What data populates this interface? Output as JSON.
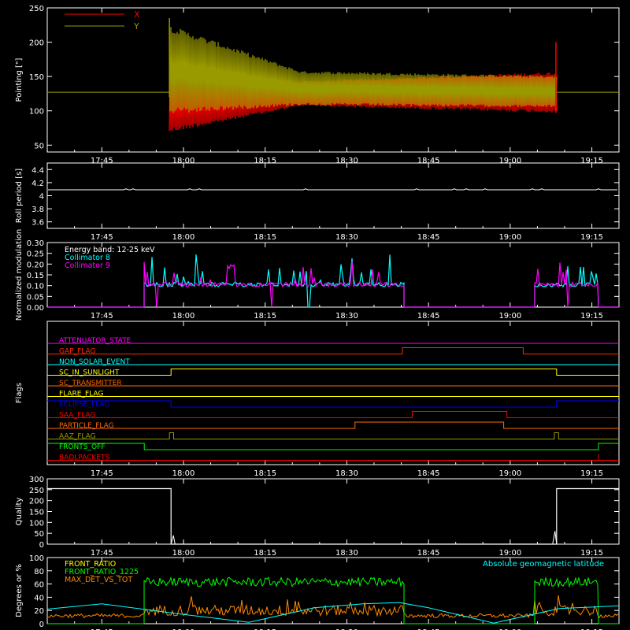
{
  "chart_data": [
    {
      "type": "line",
      "ylabel": "Pointing [\"]",
      "ylim": [
        40,
        250
      ],
      "yticks": [
        50,
        100,
        150,
        200,
        250
      ],
      "xticks": [
        "17:45",
        "18:00",
        "18:15",
        "18:30",
        "18:45",
        "19:00",
        "19:15"
      ],
      "xlim": [
        17.583,
        19.333
      ],
      "series": [
        {
          "name": "X",
          "color": "#ff0000",
          "baseline": 127,
          "segments": [
            {
              "t0": 17.957,
              "t1": 18.36,
              "center0": 118,
              "center1": 125,
              "amp0": 50,
              "amp1": 18
            },
            {
              "t0": 18.36,
              "t1": 19.142,
              "center0": 125,
              "center1": 127,
              "amp0": 18,
              "amp1": 30
            }
          ],
          "spike": {
            "t": 19.14,
            "values": [
              200,
              97
            ]
          }
        },
        {
          "name": "Y",
          "color": "#999900",
          "baseline": 127,
          "segments": [
            {
              "t0": 17.957,
              "t1": 18.36,
              "center0": 160,
              "center1": 133,
              "amp0": 65,
              "amp1": 25
            },
            {
              "t0": 18.36,
              "t1": 19.142,
              "center0": 133,
              "center1": 128,
              "amp0": 25,
              "amp1": 23
            }
          ],
          "spike": {
            "t": 17.957,
            "values": [
              235,
              120
            ]
          }
        }
      ]
    },
    {
      "type": "line",
      "ylabel": "Roll period [s]",
      "ylim": [
        3.5,
        4.5
      ],
      "yticks": [
        3.6,
        3.8,
        4.0,
        4.2,
        4.4
      ],
      "xticks": [
        "17:45",
        "18:00",
        "18:15",
        "18:30",
        "18:45",
        "19:00",
        "19:15"
      ],
      "series": [
        {
          "name": "",
          "color": "#ffffff",
          "value": 4.09
        }
      ]
    },
    {
      "type": "line",
      "ylabel": "Normalized modulation",
      "ylim": [
        0,
        0.3
      ],
      "yticks": [
        "0.00",
        "0.05",
        "0.10",
        "0.15",
        "0.20",
        "0.25",
        "0.30"
      ],
      "xticks": [
        "17:45",
        "18:00",
        "18:15",
        "18:30",
        "18:45",
        "19:00",
        "19:15"
      ],
      "legend": [
        {
          "label": "Energy band:  12-25 keV",
          "color": "#ffffff"
        },
        {
          "label": "Collimator 8",
          "color": "#00ffff"
        },
        {
          "label": "Collimator 9",
          "color": "#ff00ff"
        }
      ],
      "active_intervals": [
        [
          17.88,
          18.675
        ],
        [
          19.075,
          19.27
        ]
      ],
      "typical_level": 0.1,
      "max_spike": 0.28
    },
    {
      "type": "line",
      "ylabel": "Flags",
      "xticks": [
        "17:45",
        "18:00",
        "18:15",
        "18:30",
        "18:45",
        "19:00",
        "19:15"
      ],
      "flags": [
        {
          "name": "ATTENUATOR_STATE",
          "color": "#ff00ff",
          "steps": [
            [
              17.583,
              0
            ]
          ]
        },
        {
          "name": "GAP_FLAG",
          "color": "#ff2a00",
          "steps": [
            [
              17.583,
              0
            ],
            [
              18.67,
              1
            ],
            [
              19.04,
              0
            ]
          ]
        },
        {
          "name": "NON_SOLAR_EVENT",
          "color": "#00ffff",
          "steps": [
            [
              17.583,
              0
            ]
          ]
        },
        {
          "name": "SC_IN_SUNLIGHT",
          "color": "#ffff00",
          "steps": [
            [
              17.583,
              0
            ],
            [
              17.962,
              1
            ],
            [
              19.142,
              0
            ]
          ]
        },
        {
          "name": "SC_TRANSMITTER",
          "color": "#ff6600",
          "steps": [
            [
              17.583,
              0
            ]
          ]
        },
        {
          "name": "FLARE_FLAG",
          "color": "#ffff00",
          "steps": [
            [
              17.583,
              0
            ]
          ]
        },
        {
          "name": "ECLIPSE_FLAG",
          "color": "#0000ff",
          "steps": [
            [
              17.583,
              1
            ],
            [
              17.962,
              0
            ],
            [
              19.142,
              1
            ]
          ]
        },
        {
          "name": "SAA_FLAG",
          "color": "#ff0000",
          "steps": [
            [
              17.583,
              0
            ],
            [
              18.7,
              1
            ],
            [
              18.99,
              0
            ]
          ]
        },
        {
          "name": "PARTICLE_FLAG",
          "color": "#ff6a00",
          "steps": [
            [
              17.583,
              0
            ],
            [
              18.525,
              1
            ],
            [
              18.98,
              0
            ]
          ]
        },
        {
          "name": "AAZ_FLAG",
          "color": "#999900",
          "steps": [
            [
              17.583,
              0
            ],
            [
              17.957,
              1
            ],
            [
              17.97,
              0
            ],
            [
              19.135,
              1
            ],
            [
              19.148,
              0
            ]
          ]
        },
        {
          "name": "FRONTS_OFF",
          "color": "#00ff00",
          "steps": [
            [
              17.583,
              1
            ],
            [
              17.88,
              0
            ],
            [
              19.27,
              1
            ]
          ]
        },
        {
          "name": "BADLPACKETS",
          "color": "#ff0000",
          "steps": [
            [
              17.583,
              0
            ]
          ]
        }
      ]
    },
    {
      "type": "line",
      "ylabel": "Quality",
      "ylim": [
        0,
        300
      ],
      "yticks": [
        0,
        50,
        100,
        150,
        200,
        250,
        300
      ],
      "xticks": [
        "17:45",
        "18:00",
        "18:15",
        "18:30",
        "18:45",
        "19:00",
        "19:15"
      ],
      "series": [
        {
          "name": "",
          "color": "#ffffff",
          "points": [
            [
              17.583,
              255
            ],
            [
              17.962,
              255
            ],
            [
              17.962,
              0
            ],
            [
              19.142,
              0
            ],
            [
              19.142,
              255
            ],
            [
              19.333,
              255
            ]
          ]
        }
      ]
    },
    {
      "type": "line",
      "ylabel": "Degrees or %",
      "ylim": [
        0,
        100
      ],
      "yticks": [
        0,
        20,
        40,
        60,
        80,
        100
      ],
      "xticks": [
        "17:45",
        "18:00",
        "18:15",
        "18:30",
        "18:45",
        "19:00",
        "19:15"
      ],
      "legend": [
        {
          "label": "FRONT_RATIO",
          "color": "#ffff00"
        },
        {
          "label": "FRONT_RATIO_1225",
          "color": "#00ff00"
        },
        {
          "label": "MAX_DET_VS_TOT",
          "color": "#ff8800"
        }
      ],
      "annotation": {
        "label": "Absolute geomagnetic latitude",
        "color": "#00ffff"
      },
      "series": [
        {
          "name": "FRONT_RATIO_1225",
          "color": "#00ff00",
          "level": 63,
          "active_intervals": [
            [
              17.88,
              18.675
            ],
            [
              19.075,
              19.27
            ]
          ]
        },
        {
          "name": "MAX_DET_VS_TOT",
          "color": "#ff8800",
          "level": 20
        },
        {
          "name": "Absolute geomagnetic latitude",
          "color": "#00ffff",
          "points": [
            [
              17.583,
              22
            ],
            [
              17.75,
              30
            ],
            [
              18.0,
              14
            ],
            [
              18.2,
              2
            ],
            [
              18.4,
              24
            ],
            [
              18.55,
              30
            ],
            [
              18.66,
              32
            ],
            [
              18.75,
              24
            ],
            [
              18.95,
              1
            ],
            [
              19.15,
              23
            ],
            [
              19.333,
              27
            ]
          ]
        }
      ]
    }
  ]
}
